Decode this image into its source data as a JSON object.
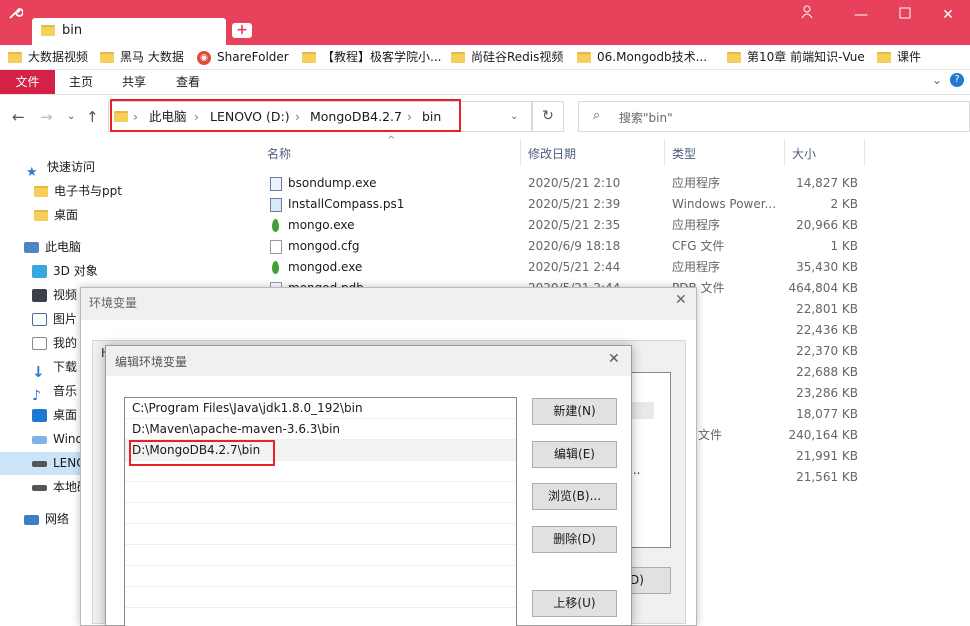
{
  "window": {
    "tab_title": "bin",
    "new_tab_icon": "plus-icon",
    "controls": [
      "person-icon",
      "minimize-icon",
      "maximize-icon",
      "close-icon"
    ]
  },
  "bookmarks": [
    "大数据视频",
    "黑马 大数据",
    "ShareFolder",
    "【教程】极客学院小...",
    "尚硅谷Redis视频",
    "06.Mongodb技术...",
    "第10章 前端知识-Vue",
    "课件"
  ],
  "ribbon": {
    "file_tab": "文件",
    "tabs": [
      "主页",
      "共享",
      "查看"
    ]
  },
  "address": {
    "crumbs": [
      "此电脑",
      "LENOVO (D:)",
      "MongoDB4.2.7",
      "bin"
    ],
    "search_placeholder": "搜索\"bin\""
  },
  "nav_pane": [
    {
      "label": "快速访问",
      "icon": "star-icon"
    },
    {
      "label": "电子书与ppt",
      "icon": "folder-icon"
    },
    {
      "label": "桌面",
      "icon": "folder-icon"
    },
    {
      "label": "此电脑",
      "icon": "computer-icon"
    },
    {
      "label": "3D 对象",
      "icon": "cube-icon"
    },
    {
      "label": "视频",
      "icon": "film-icon"
    },
    {
      "label": "图片",
      "icon": "picture-icon"
    },
    {
      "label": "我的",
      "icon": "document-icon"
    },
    {
      "label": "下载",
      "icon": "download-icon"
    },
    {
      "label": "音乐",
      "icon": "music-icon"
    },
    {
      "label": "桌面",
      "icon": "desktop-icon"
    },
    {
      "label": "Wind",
      "icon": "windows-drive-icon"
    },
    {
      "label": "LENO",
      "icon": "drive-icon"
    },
    {
      "label": "本地磁",
      "icon": "drive-icon"
    },
    {
      "label": "网络",
      "icon": "network-icon"
    }
  ],
  "columns": {
    "name": "名称",
    "date": "修改日期",
    "type": "类型",
    "size": "大小"
  },
  "files": [
    {
      "name": "bsondump.exe",
      "date": "2020/5/21 2:10",
      "type": "应用程序",
      "size": "14,827 KB"
    },
    {
      "name": "InstallCompass.ps1",
      "date": "2020/5/21 2:39",
      "type": "Windows Power...",
      "size": "2 KB"
    },
    {
      "name": "mongo.exe",
      "date": "2020/5/21 2:35",
      "type": "应用程序",
      "size": "20,966 KB"
    },
    {
      "name": "mongod.cfg",
      "date": "2020/6/9 18:18",
      "type": "CFG 文件",
      "size": "1 KB"
    },
    {
      "name": "mongod.exe",
      "date": "2020/5/21 2:44",
      "type": "应用程序",
      "size": "35,430 KB"
    },
    {
      "name": "mongod.pdb",
      "date": "2020/5/21 2:44",
      "type": "PDB 文件",
      "size": "464,804 KB"
    },
    {
      "name": "",
      "date": "",
      "type": "程序",
      "size": "22,801 KB"
    },
    {
      "name": "",
      "date": "",
      "type": "程序",
      "size": "22,436 KB"
    },
    {
      "name": "",
      "date": "",
      "type": "程序",
      "size": "22,370 KB"
    },
    {
      "name": "",
      "date": "",
      "type": "程序",
      "size": "22,688 KB"
    },
    {
      "name": "",
      "date": "",
      "type": "程序",
      "size": "23,286 KB"
    },
    {
      "name": "",
      "date": "",
      "type": "程序",
      "size": "18,077 KB"
    },
    {
      "name": "",
      "date": "",
      "type": "文件",
      "size": "240,164 KB"
    },
    {
      "name": "",
      "date": "",
      "type": "程序",
      "size": "21,991 KB"
    },
    {
      "name": "",
      "date": "",
      "type": "程序",
      "size": "21,561 KB"
    }
  ],
  "env_dialog": {
    "title": "环境变量",
    "partial_label": "H",
    "partial_button": "D)",
    "ellipsis": "..."
  },
  "edit_dialog": {
    "title": "编辑环境变量",
    "paths": [
      "C:\\Program Files\\Java\\jdk1.8.0_192\\bin",
      "D:\\Maven\\apache-maven-3.6.3\\bin",
      "D:\\MongoDB4.2.7\\bin"
    ],
    "buttons": [
      "新建(N)",
      "编辑(E)",
      "浏览(B)...",
      "删除(D)",
      "上移(U)"
    ]
  }
}
